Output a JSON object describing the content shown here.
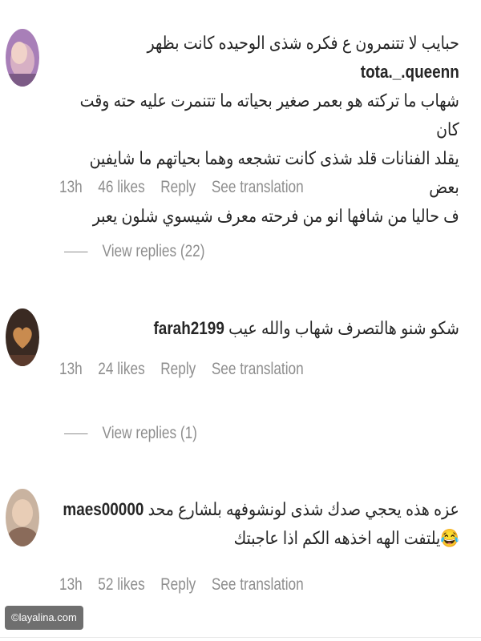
{
  "comments": [
    {
      "username": "tota._.queenn",
      "lines": [
        "حبايب لا تتنمرون ع فكره شذى الوحيده كانت بظهر",
        "شهاب ما تركته هو بعمر صغير بحياته ما تتنمرت عليه حته وقت كان",
        "يقلد الفنانات قلد شذى كانت تشجعه وهما بحياتهم ما شايفين بعض",
        "ف حاليا من شافها انو من فرحته معرف شيسوي شلون يعبر"
      ],
      "time": "13h",
      "likes": "46 likes",
      "reply": "Reply",
      "translate": "See translation",
      "view_replies": "View replies (22)"
    },
    {
      "username": "farah2199",
      "lines": [
        "شكو شنو هالتصرف شهاب والله عيب"
      ],
      "time": "13h",
      "likes": "24 likes",
      "reply": "Reply",
      "translate": "See translation",
      "view_replies": "View replies (1)"
    },
    {
      "username": "maes00000",
      "lines": [
        "عزه هذه يحجي صدك شذى لونشوفهه بلشارع محد",
        "😂يلتفت الهه اخذهه الكم اذا عاجبتك"
      ],
      "time": "13h",
      "likes": "52 likes",
      "reply": "Reply",
      "translate": "See translation"
    }
  ],
  "watermark": "©layalina.com",
  "colors": {
    "text": "#262626",
    "muted": "#8e8e8e"
  }
}
